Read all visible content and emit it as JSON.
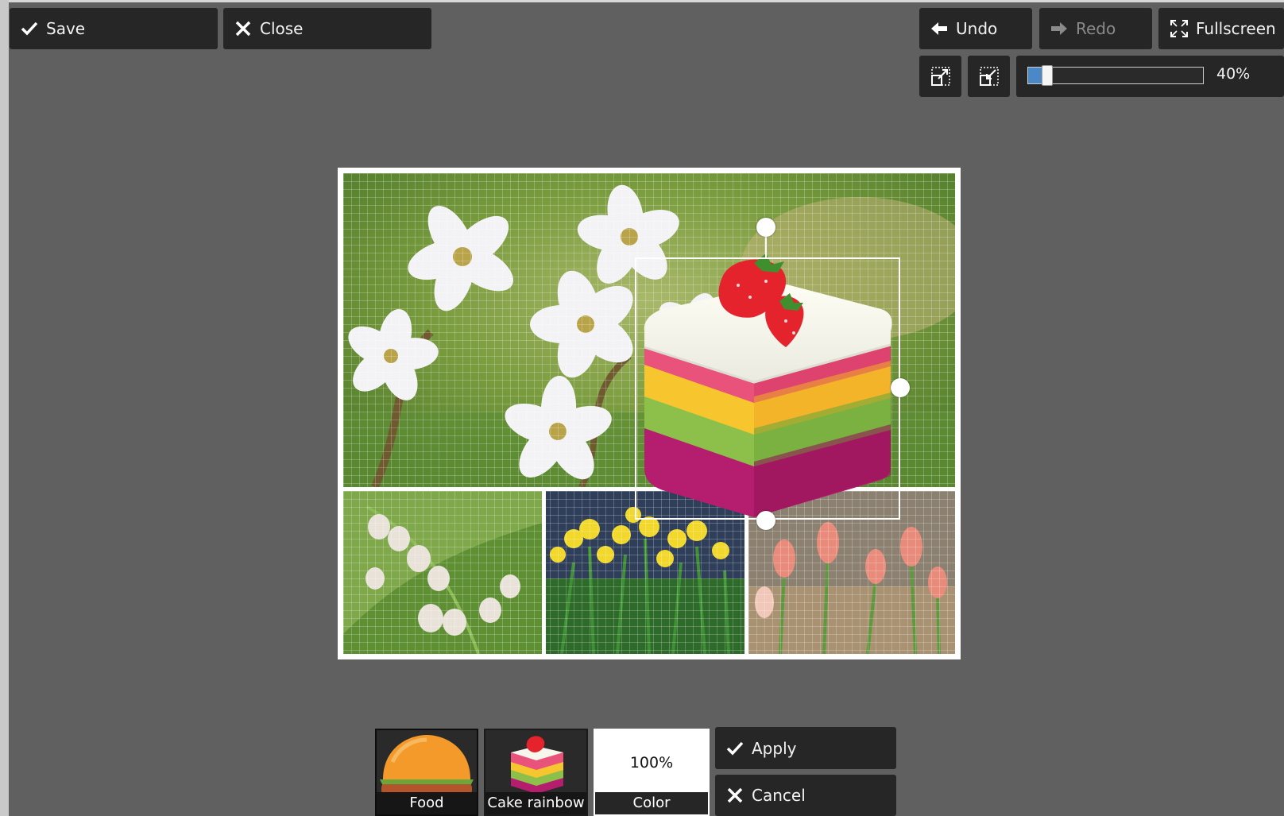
{
  "toolbar": {
    "save_label": "Save",
    "close_label": "Close",
    "undo_label": "Undo",
    "redo_label": "Redo",
    "fullscreen_label": "Fullscreen"
  },
  "zoom": {
    "value_text": "40%",
    "level": 0.08
  },
  "sticker": {
    "name": "cake-rainbow",
    "icon": "layered-cake-with-strawberries"
  },
  "bottom_panel": {
    "tiles": [
      {
        "label": "Food",
        "icon": "burger-icon",
        "selected": true
      },
      {
        "label": "Cake rainbow",
        "icon": "cake-icon",
        "selected": false
      },
      {
        "label": "Color",
        "value": "100%",
        "selected": false
      }
    ],
    "apply_label": "Apply",
    "cancel_label": "Cancel"
  },
  "colors": {
    "background": "#606060",
    "button": "#262626",
    "accent": "#4a88c8"
  }
}
